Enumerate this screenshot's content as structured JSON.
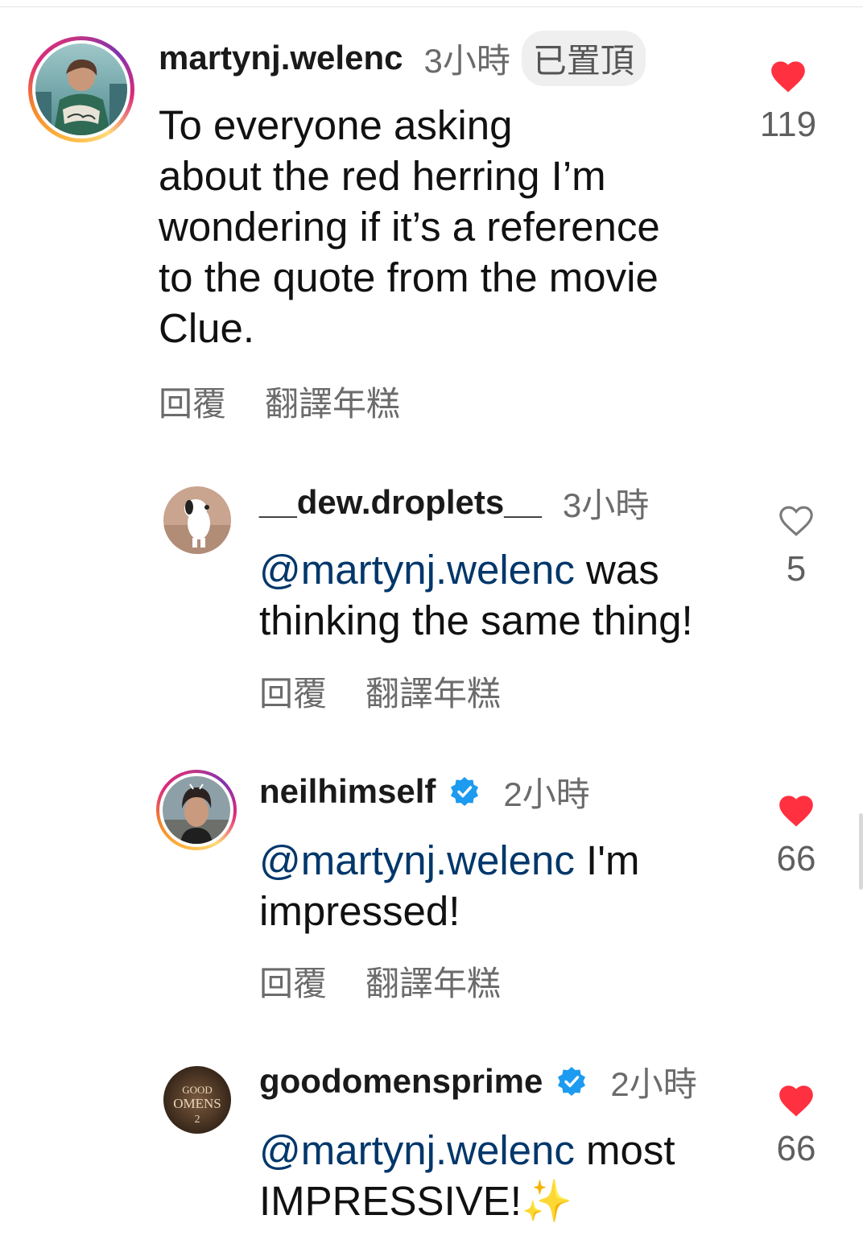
{
  "comments": [
    {
      "username": "martynj.welenc",
      "time": "3小時",
      "pinned_label": "已置頂",
      "text": "To everyone asking about the red herring I’m wondering if it’s a reference to the quote from the movie Clue.",
      "lines": [
        "To everyone asking",
        "about the red herring I’m",
        "wondering if it’s a reference",
        "to the quote from the movie",
        "Clue."
      ],
      "reply_label": "回覆",
      "translate_label": "翻譯年糕",
      "likes": "119",
      "liked": true
    },
    {
      "username": "__dew.droplets__",
      "time": "3小時",
      "mention": "@martynj.welenc",
      "text_line1_rest": " was",
      "text_line2": "thinking the same thing!",
      "reply_label": "回覆",
      "translate_label": "翻譯年糕",
      "likes": "5",
      "liked": false
    },
    {
      "username": "neilhimself",
      "time": "2小時",
      "verified": true,
      "mention": "@martynj.welenc",
      "text_line1_rest": " I'm",
      "text_line2": "impressed!",
      "reply_label": "回覆",
      "translate_label": "翻譯年糕",
      "likes": "66",
      "liked": true
    },
    {
      "username": "goodomensprime",
      "time": "2小時",
      "verified": true,
      "mention": "@martynj.welenc",
      "text_line1_rest": " most",
      "text_line2": "IMPRESSIVE!",
      "emoji": "✨",
      "likes": "66",
      "liked": true
    }
  ],
  "colors": {
    "like_red": "#ff3040",
    "mention_blue": "#00376b",
    "verified_blue": "#1d9bf0",
    "secondary_text": "#6b6b6b"
  },
  "icons": {
    "liked": "heart-filled-icon",
    "unliked": "heart-outline-icon",
    "verified": "verified-badge-icon",
    "emoji": "sparkles"
  }
}
